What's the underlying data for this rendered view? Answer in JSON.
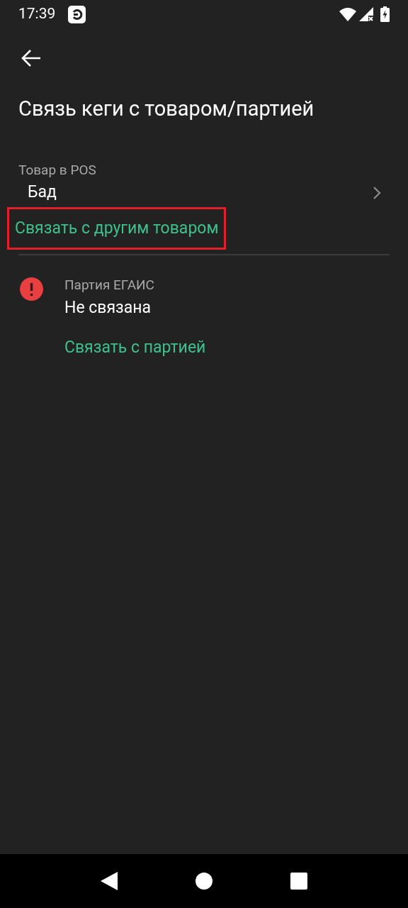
{
  "status_bar": {
    "time": "17:39"
  },
  "title": "Связь кеги с товаром/партией",
  "pos_item": {
    "label": "Товар в POS",
    "value": "Бад",
    "link": {
      "label": "Связать с другим товаром",
      "highlighted": true
    }
  },
  "egais_batch": {
    "error": true,
    "label": "Партия ЕГАИС",
    "value": "Не связана",
    "link": {
      "label": "Связать с партией",
      "highlighted": false
    }
  }
}
